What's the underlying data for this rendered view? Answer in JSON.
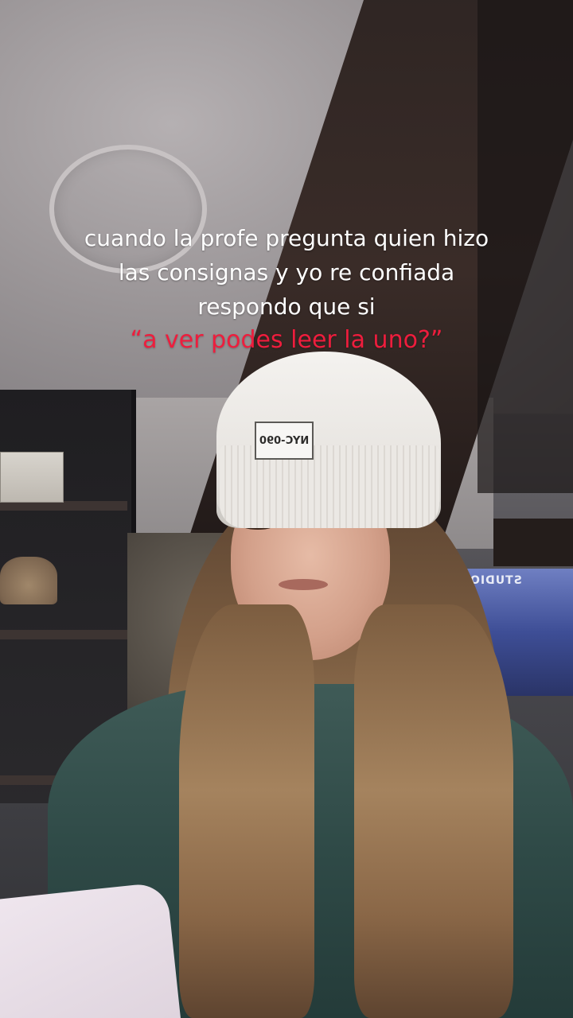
{
  "caption": {
    "lines": [
      "cuando la profe pregunta quien hizo",
      "las consignas y yo re confiada",
      "respondo que si"
    ],
    "quote": "“a ver podes leer la uno?”"
  },
  "scene": {
    "beanie_patch_text": "NYC-090",
    "tv_label": "STUDIO"
  },
  "colors": {
    "caption_white": "#ffffff",
    "caption_red": "#ee1d3d",
    "beanie": "#f4f2ef",
    "sweater": "#2f4a47"
  }
}
